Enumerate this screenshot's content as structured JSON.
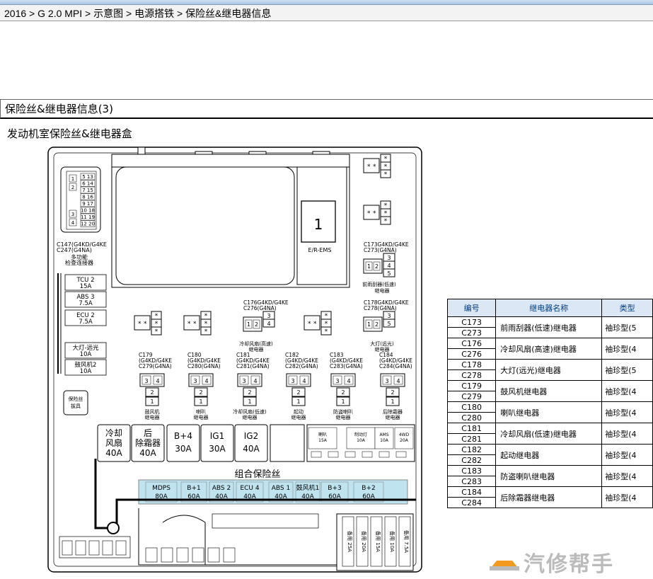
{
  "breadcrumb": {
    "items": [
      "2016",
      "G 2.0 MPI",
      "示意图",
      "电源搭铁",
      "保险丝&继电器信息"
    ],
    "separator": " > "
  },
  "section_title": "保险丝&继电器信息(3)",
  "subsection_title": "发动机室保险丝&继电器盒",
  "diagram": {
    "connector_top": {
      "code1": "C147(G4KD/G4KE",
      "code2": "C247(G4NA)",
      "name1": "多功能",
      "name2": "检查连接器",
      "pins_left": [
        "1",
        "2"
      ],
      "pins_left_low": [
        "3",
        "4"
      ],
      "pins_right": [
        "5 13",
        "6 14",
        "7 15",
        "8 16",
        "9 17",
        "10 18",
        "11 19",
        "12 20"
      ]
    },
    "big_relay": {
      "number": "1",
      "label": "E/R-EMS"
    },
    "relay_c173": {
      "code1": "C173G4KD/G4KE",
      "code2": "C273(G4NA)",
      "pins": [
        "1",
        "2",
        "3",
        "4",
        "5"
      ],
      "name1": "前雨刮器(低速)",
      "name2": "继电器"
    },
    "relay_c176": {
      "code1": "C176G4KD/G4KE",
      "code2": "C276(G4NA)",
      "pins": [
        "1",
        "2",
        "3",
        "4"
      ],
      "name1": "冷却风扇(高速)",
      "name2": "继电器"
    },
    "relay_c178": {
      "code1": "C178G4KD/G4KE",
      "code2": "C278(G4NA)",
      "pins": [
        "1",
        "2",
        "3",
        "5"
      ],
      "name1": "大灯(远光)",
      "name2": "继电器"
    },
    "star": "*",
    "left_fuses": [
      {
        "name": "TCU 2",
        "amp": "15A"
      },
      {
        "name": "ABS 3",
        "amp": "7.5A"
      },
      {
        "name": "ECU 2",
        "amp": "7.5A"
      },
      {
        "name": "大灯-远光",
        "amp": "10A"
      },
      {
        "name": "鼓风机2",
        "amp": "10A"
      }
    ],
    "fuse_tool": {
      "line1": "保险丝",
      "line2": "拔具"
    },
    "small_relays": [
      {
        "code1": "C179",
        "code2": "(G4KD/G4KE",
        "code3": "C279(G4NA)",
        "name1": "鼓风机",
        "name2": "继电器"
      },
      {
        "code1": "C180",
        "code2": "(G4KD/G4KE",
        "code3": "C280(G4NA)",
        "name1": "喇叭",
        "name2": "继电器"
      },
      {
        "code1": "C181",
        "code2": "(G4KD/G4KE",
        "code3": "C281(G4NA)",
        "name1": "冷却风扇(低速)",
        "name2": "继电器"
      },
      {
        "code1": "C182",
        "code2": "(G4KD/G4KE",
        "code3": "C282(G4NA)",
        "name1": "起动",
        "name2": "继电器"
      },
      {
        "code1": "C183",
        "code2": "(G4KD/G4KE",
        "code3": "C283(G4NA)",
        "name1": "防盗喇叭",
        "name2": "继电器"
      },
      {
        "code1": "C184",
        "code2": "(G4KD/G4KE",
        "code3": "C284(G4NA)",
        "name1": "后除霜器",
        "name2": "继电器"
      }
    ],
    "small_relay_pins": [
      "3",
      "4",
      "2",
      "1"
    ],
    "big_fuses": [
      {
        "l1": "冷却",
        "l2": "风扇",
        "amp": "40A"
      },
      {
        "l1": "后",
        "l2": "除霜器",
        "amp": "40A"
      },
      {
        "l1": "B+4",
        "l2": "",
        "amp": "30A"
      },
      {
        "l1": "IG1",
        "l2": "",
        "amp": "30A"
      },
      {
        "l1": "IG2",
        "l2": "",
        "amp": "40A"
      }
    ],
    "mini_fuses": [
      {
        "name": "喇叭",
        "amp": "15A"
      },
      {
        "name": "制动灯",
        "amp": "10A"
      },
      {
        "name": "AMS",
        "amp": "10A"
      },
      {
        "name": "4WD",
        "amp": "20A"
      }
    ],
    "combo_title": "组合保险丝",
    "combo_fuses": [
      {
        "name": "MDPS",
        "amp": "80A"
      },
      {
        "name": "B+1",
        "amp": "60A"
      },
      {
        "name": "ABS 2",
        "amp": "40A"
      },
      {
        "name": "ECU 4",
        "amp": "40A"
      },
      {
        "name": "ABS 1",
        "amp": "40A"
      },
      {
        "name": "鼓风机1",
        "amp": "40A"
      },
      {
        "name": "B+3",
        "amp": "60A"
      },
      {
        "name": "B+2",
        "amp": "60A"
      }
    ],
    "spare_fuses": [
      "备用 25A",
      "备用 20A",
      "备用 15A",
      "备用 10A",
      "备用 7.5A"
    ]
  },
  "relay_table": {
    "headers": [
      "编号",
      "继电器名称",
      "类型"
    ],
    "rows": [
      {
        "codes": [
          "C173",
          "C273"
        ],
        "name": "前雨刮器(低速)继电器",
        "type": "袖珍型(5"
      },
      {
        "codes": [
          "C176",
          "C276"
        ],
        "name": "冷却风扇(高速)继电器",
        "type": "袖珍型(4"
      },
      {
        "codes": [
          "C178",
          "C278"
        ],
        "name": "大灯(远光)继电器",
        "type": "袖珍型(5"
      },
      {
        "codes": [
          "C179",
          "C279"
        ],
        "name": "鼓风机继电器",
        "type": "袖珍型(4"
      },
      {
        "codes": [
          "C180",
          "C280"
        ],
        "name": "喇叭继电器",
        "type": "袖珍型(4"
      },
      {
        "codes": [
          "C181",
          "C281"
        ],
        "name": "冷却风扇(低速)继电器",
        "type": "袖珍型(4"
      },
      {
        "codes": [
          "C182",
          "C282"
        ],
        "name": "起动继电器",
        "type": "袖珍型(4"
      },
      {
        "codes": [
          "C183",
          "C283"
        ],
        "name": "防盗喇叭继电器",
        "type": "袖珍型(4"
      },
      {
        "codes": [
          "C184",
          "C284"
        ],
        "name": "后除霜器继电器",
        "type": "袖珍型(4"
      }
    ]
  },
  "watermark": "汽修帮手",
  "colors": {
    "fuse_blue": "#bfe3ef",
    "header_blue": "#dbe7f5",
    "logo_orange": "#f39a1e"
  }
}
